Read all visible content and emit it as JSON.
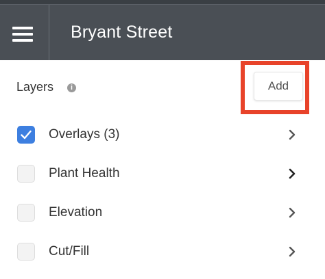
{
  "header": {
    "title": "Bryant Street",
    "menu_icon": "hamburger-menu-icon"
  },
  "layers_panel": {
    "heading": "Layers",
    "info_icon": "info-icon",
    "info_glyph": "i",
    "add_label": "Add",
    "highlight_color": "#e8432a",
    "items": [
      {
        "label": "Overlays (3)",
        "checked": true
      },
      {
        "label": "Plant Health",
        "checked": false
      },
      {
        "label": "Elevation",
        "checked": false
      },
      {
        "label": "Cut/Fill",
        "checked": false
      }
    ]
  },
  "colors": {
    "header_bg": "#4a4f55",
    "checkbox_checked": "#3d7fe0"
  }
}
